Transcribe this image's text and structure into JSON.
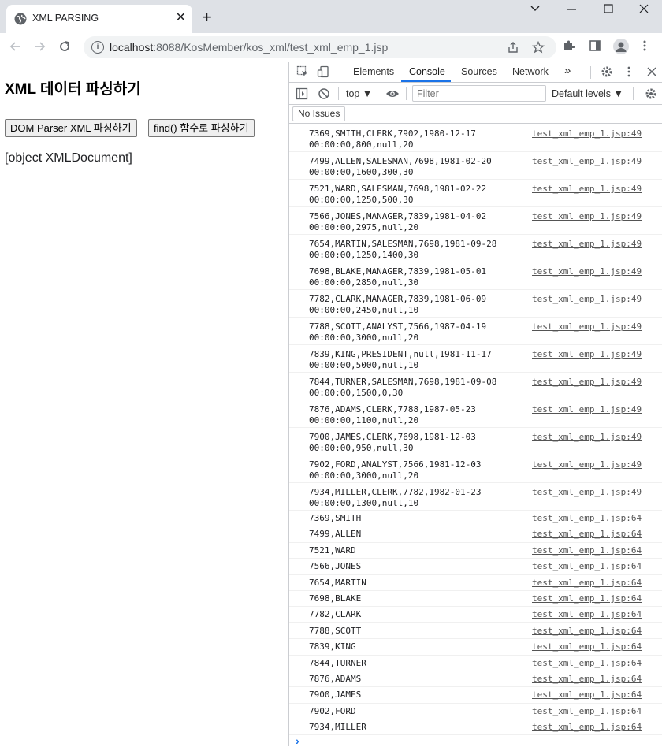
{
  "browser": {
    "tab_title": "XML PARSING",
    "new_tab_symbol": "+",
    "url_host": "localhost",
    "url_rest": ":8088/KosMember/kos_xml/test_xml_emp_1.jsp"
  },
  "page": {
    "heading": "XML 데이터 파싱하기",
    "dom_button": "DOM Parser XML 파싱하기",
    "find_button": "find() 함수로 파싱하기",
    "result": "[object XMLDocument]"
  },
  "devtools": {
    "tabs": [
      "Elements",
      "Console",
      "Sources",
      "Network"
    ],
    "more_tabs": "»",
    "context": "top ▼",
    "filter_placeholder": "Filter",
    "levels": "Default levels ▼",
    "issues_label": "No Issues",
    "console_messages": [
      {
        "line1": "7369,SMITH,CLERK,7902,1980-12-17",
        "line2": "00:00:00,800,null,20",
        "source": "test_xml_emp_1.jsp:49"
      },
      {
        "line1": "7499,ALLEN,SALESMAN,7698,1981-02-20",
        "line2": "00:00:00,1600,300,30",
        "source": "test_xml_emp_1.jsp:49"
      },
      {
        "line1": "7521,WARD,SALESMAN,7698,1981-02-22",
        "line2": "00:00:00,1250,500,30",
        "source": "test_xml_emp_1.jsp:49"
      },
      {
        "line1": "7566,JONES,MANAGER,7839,1981-04-02",
        "line2": "00:00:00,2975,null,20",
        "source": "test_xml_emp_1.jsp:49"
      },
      {
        "line1": "7654,MARTIN,SALESMAN,7698,1981-09-28",
        "line2": "00:00:00,1250,1400,30",
        "source": "test_xml_emp_1.jsp:49"
      },
      {
        "line1": "7698,BLAKE,MANAGER,7839,1981-05-01",
        "line2": "00:00:00,2850,null,30",
        "source": "test_xml_emp_1.jsp:49"
      },
      {
        "line1": "7782,CLARK,MANAGER,7839,1981-06-09",
        "line2": "00:00:00,2450,null,10",
        "source": "test_xml_emp_1.jsp:49"
      },
      {
        "line1": "7788,SCOTT,ANALYST,7566,1987-04-19",
        "line2": "00:00:00,3000,null,20",
        "source": "test_xml_emp_1.jsp:49"
      },
      {
        "line1": "7839,KING,PRESIDENT,null,1981-11-17",
        "line2": "00:00:00,5000,null,10",
        "source": "test_xml_emp_1.jsp:49"
      },
      {
        "line1": "7844,TURNER,SALESMAN,7698,1981-09-08",
        "line2": "00:00:00,1500,0,30",
        "source": "test_xml_emp_1.jsp:49"
      },
      {
        "line1": "7876,ADAMS,CLERK,7788,1987-05-23",
        "line2": "00:00:00,1100,null,20",
        "source": "test_xml_emp_1.jsp:49"
      },
      {
        "line1": "7900,JAMES,CLERK,7698,1981-12-03",
        "line2": "00:00:00,950,null,30",
        "source": "test_xml_emp_1.jsp:49"
      },
      {
        "line1": "7902,FORD,ANALYST,7566,1981-12-03",
        "line2": "00:00:00,3000,null,20",
        "source": "test_xml_emp_1.jsp:49"
      },
      {
        "line1": "7934,MILLER,CLERK,7782,1982-01-23",
        "line2": "00:00:00,1300,null,10",
        "source": "test_xml_emp_1.jsp:49"
      },
      {
        "line1": "7369,SMITH",
        "source": "test_xml_emp_1.jsp:64"
      },
      {
        "line1": "7499,ALLEN",
        "source": "test_xml_emp_1.jsp:64"
      },
      {
        "line1": "7521,WARD",
        "source": "test_xml_emp_1.jsp:64"
      },
      {
        "line1": "7566,JONES",
        "source": "test_xml_emp_1.jsp:64"
      },
      {
        "line1": "7654,MARTIN",
        "source": "test_xml_emp_1.jsp:64"
      },
      {
        "line1": "7698,BLAKE",
        "source": "test_xml_emp_1.jsp:64"
      },
      {
        "line1": "7782,CLARK",
        "source": "test_xml_emp_1.jsp:64"
      },
      {
        "line1": "7788,SCOTT",
        "source": "test_xml_emp_1.jsp:64"
      },
      {
        "line1": "7839,KING",
        "source": "test_xml_emp_1.jsp:64"
      },
      {
        "line1": "7844,TURNER",
        "source": "test_xml_emp_1.jsp:64"
      },
      {
        "line1": "7876,ADAMS",
        "source": "test_xml_emp_1.jsp:64"
      },
      {
        "line1": "7900,JAMES",
        "source": "test_xml_emp_1.jsp:64"
      },
      {
        "line1": "7902,FORD",
        "source": "test_xml_emp_1.jsp:64"
      },
      {
        "line1": "7934,MILLER",
        "source": "test_xml_emp_1.jsp:64"
      }
    ],
    "prompt_symbol": "›"
  },
  "colors": {
    "accent": "#1a73e8",
    "tabstrip": "#dee1e6"
  }
}
